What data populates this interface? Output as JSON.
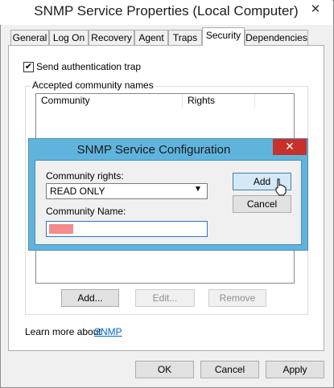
{
  "window": {
    "title": "SNMP Service Properties (Local Computer)"
  },
  "tabs": [
    "General",
    "Log On",
    "Recovery",
    "Agent",
    "Traps",
    "Security",
    "Dependencies"
  ],
  "active_tab": "Security",
  "security": {
    "send_auth_trap_label": "Send authentication trap",
    "send_auth_trap_checked": true,
    "group_label": "Accepted community names",
    "columns": [
      "Community",
      "Rights"
    ],
    "buttons": {
      "add": "Add...",
      "edit": "Edit...",
      "remove": "Remove"
    },
    "learn_more_text": "Learn more about",
    "learn_more_link": "SNMP"
  },
  "footer": {
    "ok": "OK",
    "cancel": "Cancel",
    "apply": "Apply"
  },
  "dialog": {
    "title": "SNMP Service Configuration",
    "rights_label": "Community rights:",
    "rights_value": "READ ONLY",
    "name_label": "Community Name:",
    "add": "Add",
    "cancel": "Cancel"
  }
}
